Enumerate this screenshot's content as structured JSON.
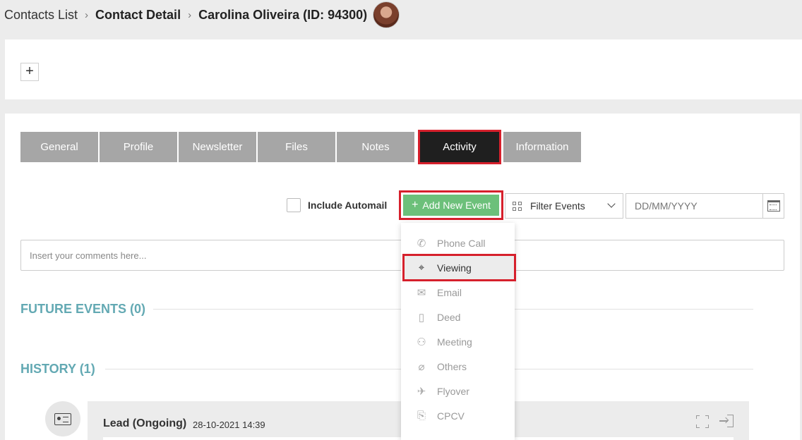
{
  "breadcrumb": {
    "contacts_list": "Contacts List",
    "contact_detail": "Contact Detail",
    "contact_name": "Carolina Oliveira (ID: 94300)"
  },
  "top_panel": {
    "add_symbol": "+"
  },
  "tabs": [
    {
      "label": "General"
    },
    {
      "label": "Profile"
    },
    {
      "label": "Newsletter"
    },
    {
      "label": "Files"
    },
    {
      "label": "Notes"
    },
    {
      "label": "Activity",
      "active": true
    },
    {
      "label": "Information"
    }
  ],
  "toolbar": {
    "include_automail": "Include Automail",
    "add_new_event": "Add New Event",
    "add_symbol": "+",
    "filter_events": "Filter Events",
    "date_placeholder": "DD/MM/YYYY"
  },
  "comments": {
    "placeholder": "Insert your comments here..."
  },
  "sections": {
    "future_events": "FUTURE EVENTS (0)",
    "history": "HISTORY (1)"
  },
  "history_item": {
    "title": "Lead (Ongoing)",
    "date": "28-10-2021 14:39"
  },
  "event_menu": [
    {
      "label": "Phone Call",
      "icon": "phone-icon",
      "glyph": "✆"
    },
    {
      "label": "Viewing",
      "icon": "viewing-icon",
      "glyph": "⌖",
      "highlighted": true
    },
    {
      "label": "Email",
      "icon": "email-icon",
      "glyph": "✉"
    },
    {
      "label": "Deed",
      "icon": "deed-icon",
      "glyph": "▯"
    },
    {
      "label": "Meeting",
      "icon": "meeting-icon",
      "glyph": "⚇"
    },
    {
      "label": "Others",
      "icon": "paperclip-icon",
      "glyph": "⌀"
    },
    {
      "label": "Flyover",
      "icon": "flyover-icon",
      "glyph": "✈"
    },
    {
      "label": "CPCV",
      "icon": "cpcv-icon",
      "glyph": "⎘"
    }
  ],
  "colors": {
    "accent_green": "#6cc07a",
    "section_teal": "#63a9b3",
    "active_tab": "#1f1f1f",
    "inactive_tab": "#a6a6a6",
    "highlight_red": "#d6202c"
  }
}
